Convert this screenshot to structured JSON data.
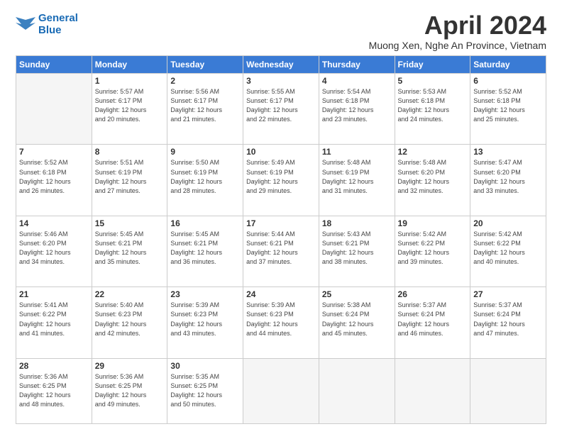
{
  "logo": {
    "line1": "General",
    "line2": "Blue"
  },
  "title": "April 2024",
  "subtitle": "Muong Xen, Nghe An Province, Vietnam",
  "headers": [
    "Sunday",
    "Monday",
    "Tuesday",
    "Wednesday",
    "Thursday",
    "Friday",
    "Saturday"
  ],
  "weeks": [
    [
      {
        "day": "",
        "info": ""
      },
      {
        "day": "1",
        "info": "Sunrise: 5:57 AM\nSunset: 6:17 PM\nDaylight: 12 hours\nand 20 minutes."
      },
      {
        "day": "2",
        "info": "Sunrise: 5:56 AM\nSunset: 6:17 PM\nDaylight: 12 hours\nand 21 minutes."
      },
      {
        "day": "3",
        "info": "Sunrise: 5:55 AM\nSunset: 6:17 PM\nDaylight: 12 hours\nand 22 minutes."
      },
      {
        "day": "4",
        "info": "Sunrise: 5:54 AM\nSunset: 6:18 PM\nDaylight: 12 hours\nand 23 minutes."
      },
      {
        "day": "5",
        "info": "Sunrise: 5:53 AM\nSunset: 6:18 PM\nDaylight: 12 hours\nand 24 minutes."
      },
      {
        "day": "6",
        "info": "Sunrise: 5:52 AM\nSunset: 6:18 PM\nDaylight: 12 hours\nand 25 minutes."
      }
    ],
    [
      {
        "day": "7",
        "info": "Sunrise: 5:52 AM\nSunset: 6:18 PM\nDaylight: 12 hours\nand 26 minutes."
      },
      {
        "day": "8",
        "info": "Sunrise: 5:51 AM\nSunset: 6:19 PM\nDaylight: 12 hours\nand 27 minutes."
      },
      {
        "day": "9",
        "info": "Sunrise: 5:50 AM\nSunset: 6:19 PM\nDaylight: 12 hours\nand 28 minutes."
      },
      {
        "day": "10",
        "info": "Sunrise: 5:49 AM\nSunset: 6:19 PM\nDaylight: 12 hours\nand 29 minutes."
      },
      {
        "day": "11",
        "info": "Sunrise: 5:48 AM\nSunset: 6:19 PM\nDaylight: 12 hours\nand 31 minutes."
      },
      {
        "day": "12",
        "info": "Sunrise: 5:48 AM\nSunset: 6:20 PM\nDaylight: 12 hours\nand 32 minutes."
      },
      {
        "day": "13",
        "info": "Sunrise: 5:47 AM\nSunset: 6:20 PM\nDaylight: 12 hours\nand 33 minutes."
      }
    ],
    [
      {
        "day": "14",
        "info": "Sunrise: 5:46 AM\nSunset: 6:20 PM\nDaylight: 12 hours\nand 34 minutes."
      },
      {
        "day": "15",
        "info": "Sunrise: 5:45 AM\nSunset: 6:21 PM\nDaylight: 12 hours\nand 35 minutes."
      },
      {
        "day": "16",
        "info": "Sunrise: 5:45 AM\nSunset: 6:21 PM\nDaylight: 12 hours\nand 36 minutes."
      },
      {
        "day": "17",
        "info": "Sunrise: 5:44 AM\nSunset: 6:21 PM\nDaylight: 12 hours\nand 37 minutes."
      },
      {
        "day": "18",
        "info": "Sunrise: 5:43 AM\nSunset: 6:21 PM\nDaylight: 12 hours\nand 38 minutes."
      },
      {
        "day": "19",
        "info": "Sunrise: 5:42 AM\nSunset: 6:22 PM\nDaylight: 12 hours\nand 39 minutes."
      },
      {
        "day": "20",
        "info": "Sunrise: 5:42 AM\nSunset: 6:22 PM\nDaylight: 12 hours\nand 40 minutes."
      }
    ],
    [
      {
        "day": "21",
        "info": "Sunrise: 5:41 AM\nSunset: 6:22 PM\nDaylight: 12 hours\nand 41 minutes."
      },
      {
        "day": "22",
        "info": "Sunrise: 5:40 AM\nSunset: 6:23 PM\nDaylight: 12 hours\nand 42 minutes."
      },
      {
        "day": "23",
        "info": "Sunrise: 5:39 AM\nSunset: 6:23 PM\nDaylight: 12 hours\nand 43 minutes."
      },
      {
        "day": "24",
        "info": "Sunrise: 5:39 AM\nSunset: 6:23 PM\nDaylight: 12 hours\nand 44 minutes."
      },
      {
        "day": "25",
        "info": "Sunrise: 5:38 AM\nSunset: 6:24 PM\nDaylight: 12 hours\nand 45 minutes."
      },
      {
        "day": "26",
        "info": "Sunrise: 5:37 AM\nSunset: 6:24 PM\nDaylight: 12 hours\nand 46 minutes."
      },
      {
        "day": "27",
        "info": "Sunrise: 5:37 AM\nSunset: 6:24 PM\nDaylight: 12 hours\nand 47 minutes."
      }
    ],
    [
      {
        "day": "28",
        "info": "Sunrise: 5:36 AM\nSunset: 6:25 PM\nDaylight: 12 hours\nand 48 minutes."
      },
      {
        "day": "29",
        "info": "Sunrise: 5:36 AM\nSunset: 6:25 PM\nDaylight: 12 hours\nand 49 minutes."
      },
      {
        "day": "30",
        "info": "Sunrise: 5:35 AM\nSunset: 6:25 PM\nDaylight: 12 hours\nand 50 minutes."
      },
      {
        "day": "",
        "info": ""
      },
      {
        "day": "",
        "info": ""
      },
      {
        "day": "",
        "info": ""
      },
      {
        "day": "",
        "info": ""
      }
    ]
  ]
}
